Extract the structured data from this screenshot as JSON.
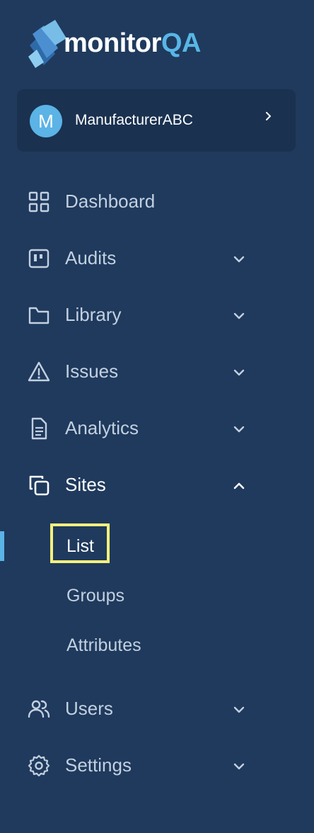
{
  "brand": {
    "logo_main": "monitor",
    "logo_accent": "QA",
    "accent_color": "#58b6e6"
  },
  "org": {
    "initial": "M",
    "name": "ManufacturerABC"
  },
  "nav": {
    "dashboard": "Dashboard",
    "audits": "Audits",
    "library": "Library",
    "issues": "Issues",
    "analytics": "Analytics",
    "sites": "Sites",
    "users": "Users",
    "settings": "Settings"
  },
  "sites_sub": {
    "list": "List",
    "groups": "Groups",
    "attributes": "Attributes"
  },
  "icons": {
    "dashboard": "grid-icon",
    "audits": "board-icon",
    "library": "folder-icon",
    "issues": "warning-icon",
    "analytics": "document-icon",
    "sites": "copy-icon",
    "users": "users-icon",
    "settings": "gear-icon"
  }
}
